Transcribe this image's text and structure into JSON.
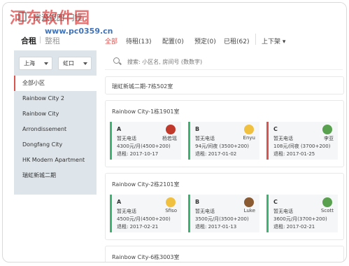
{
  "header": {
    "title": "房源",
    "subtitle": "房源视图  门锁"
  },
  "watermark": {
    "text": "河东软件园",
    "url": "www.pc0359.cn"
  },
  "rent_tabs": [
    "合租",
    "整租"
  ],
  "filter_tabs": [
    "全部",
    "待租(13)",
    "配置(0)",
    "预定(0)",
    "已租(62)"
  ],
  "sort_label": "上下架",
  "sidebar": {
    "city": "上海",
    "district": "虹口",
    "items": [
      "全部小区",
      "Rainbow City 2",
      "Rainbow City",
      "Arrondissement",
      "Dongfang City",
      "HK Modern Apartment",
      "瑞虹新城二期"
    ]
  },
  "search": {
    "placeholder": "搜索: 小区名, 房间号 (数数字)"
  },
  "community_header": "瑞虹新城二期-7栋502室",
  "rooms": [
    {
      "title": "Rainbow City-1栋1901室",
      "cards": [
        {
          "label": "A",
          "phone": "暂无电话",
          "price": "4300元/月(4500+200)",
          "lease": "退租: 2017-10-17",
          "tenant": "杨若瑶",
          "color": "green",
          "avatar": "red"
        },
        {
          "label": "B",
          "phone": "暂无电话",
          "price": "94元/间夜 (3500+200)",
          "lease": "退租: 2017-01-02",
          "tenant": "Enyu",
          "color": "green",
          "avatar": "yel"
        },
        {
          "label": "C",
          "phone": "暂无电话",
          "price": "108元/间夜 (3700+200)",
          "lease": "退租: 2017-01-25",
          "tenant": "李亚",
          "color": "red",
          "avatar": "grn"
        }
      ]
    },
    {
      "title": "Rainbow City-2栋2101室",
      "cards": [
        {
          "label": "A",
          "phone": "暂无电话",
          "price": "4500元/月(4500+200)",
          "lease": "退租: 2017-02-21",
          "tenant": "Sfiso",
          "color": "green",
          "avatar": "yel"
        },
        {
          "label": "B",
          "phone": "暂无电话",
          "price": "3500元/月(3500+200)",
          "lease": "退租: 2017-01-13",
          "tenant": "Luke",
          "color": "green",
          "avatar": "brn"
        },
        {
          "label": "C",
          "phone": "暂无电话",
          "price": "3600元/月(3700+200)",
          "lease": "退租: 2017-02-21",
          "tenant": "Scott",
          "color": "green",
          "avatar": "grn"
        }
      ]
    }
  ],
  "third_room": "Rainbow City-6栋3003室",
  "colors": {
    "accent": "#d9534f",
    "green": "#3cb371",
    "sidebar": "#dde4ea"
  }
}
